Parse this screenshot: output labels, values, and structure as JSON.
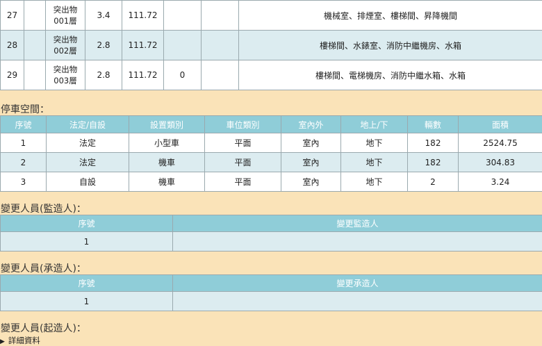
{
  "floor_rows": [
    {
      "no": "27",
      "name": [
        "突出物",
        "001層"
      ],
      "height": "3.4",
      "area": "111.72",
      "count": "",
      "extra": "",
      "use": "機械室、排煙室、樓梯間、昇降機間"
    },
    {
      "no": "28",
      "name": [
        "突出物",
        "002層"
      ],
      "height": "2.8",
      "area": "111.72",
      "count": "",
      "extra": "",
      "use": "樓梯間、水錶室、消防中繼機房、水箱"
    },
    {
      "no": "29",
      "name": [
        "突出物",
        "003層"
      ],
      "height": "2.8",
      "area": "111.72",
      "count": "0",
      "extra": "",
      "use": "樓梯間、電梯機房、消防中繼水箱、水箱"
    }
  ],
  "parking": {
    "title": "停車空間：",
    "headers": [
      "序號",
      "法定/自設",
      "設置類別",
      "車位類別",
      "室內外",
      "地上/下",
      "輛數",
      "面積"
    ],
    "rows": [
      [
        "1",
        "法定",
        "小型車",
        "平面",
        "室內",
        "地下",
        "182",
        "2524.75"
      ],
      [
        "2",
        "法定",
        "機車",
        "平面",
        "室內",
        "地下",
        "182",
        "304.83"
      ],
      [
        "3",
        "自設",
        "機車",
        "平面",
        "室內",
        "地下",
        "2",
        "3.24"
      ]
    ]
  },
  "supervisor": {
    "title": "變更人員(監造人)：",
    "headers": [
      "序號",
      "變更監造人"
    ],
    "rows": [
      [
        "1",
        ""
      ]
    ]
  },
  "contractor": {
    "title": "變更人員(承造人)：",
    "headers": [
      "序號",
      "變更承造人"
    ],
    "rows": [
      [
        "1",
        ""
      ]
    ]
  },
  "builder": {
    "title": "變更人員(起造人)：",
    "details_label": "詳細資料"
  }
}
